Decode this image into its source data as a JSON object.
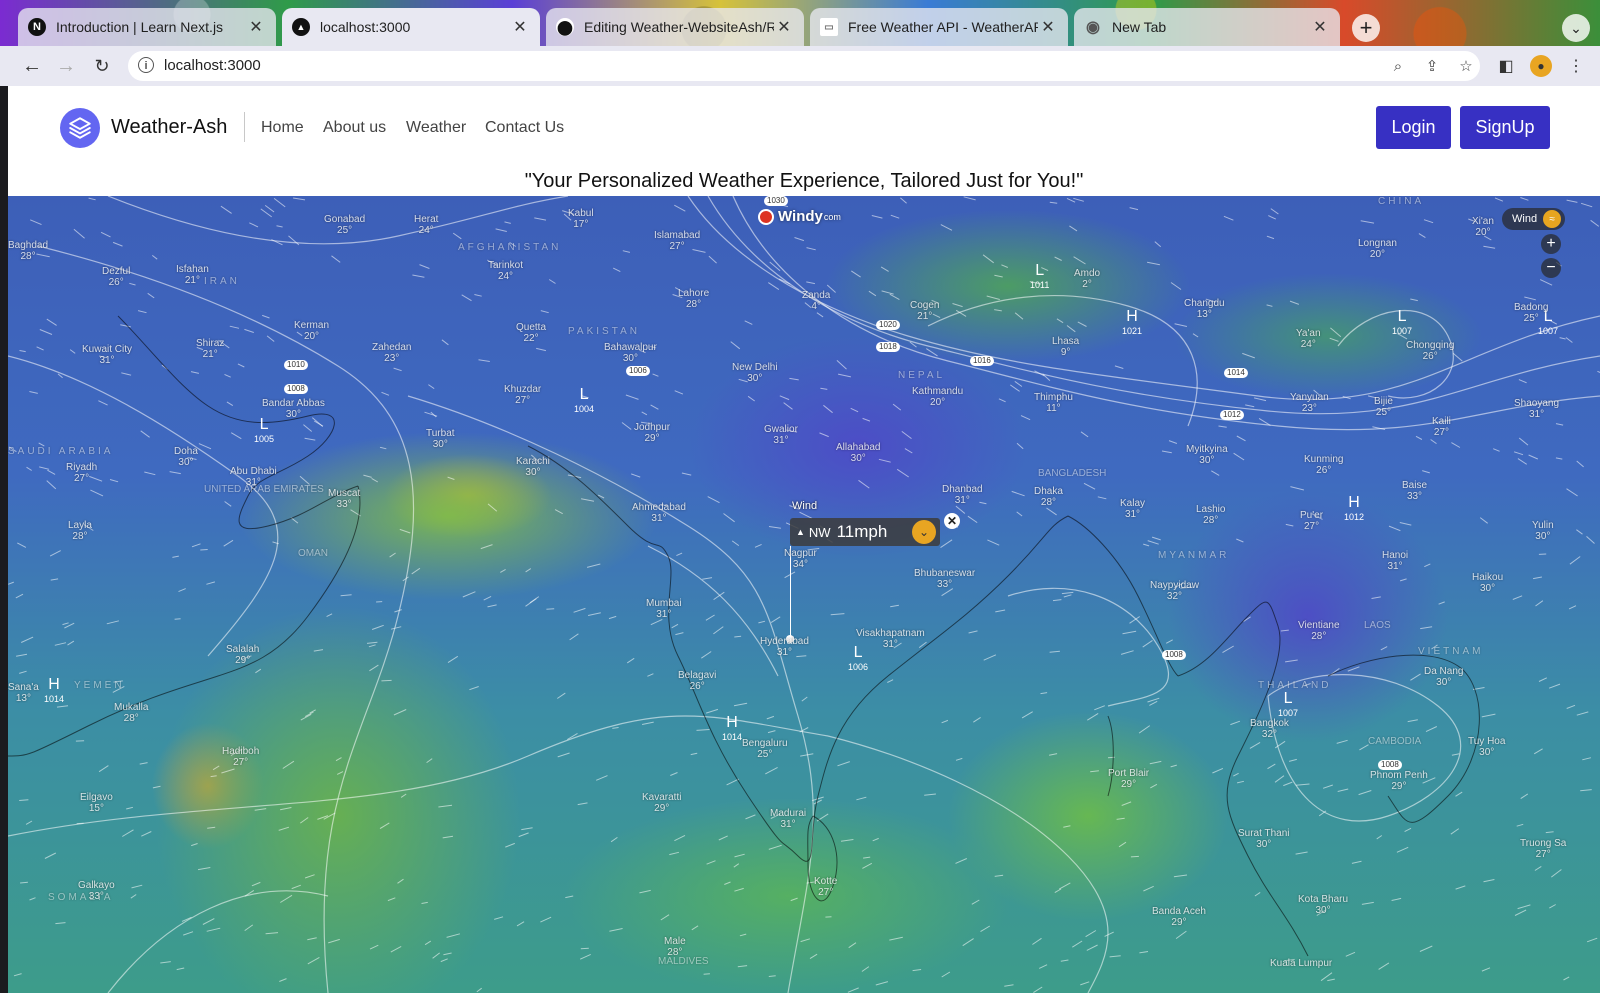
{
  "browser": {
    "tabs": [
      {
        "title": "Introduction | Learn Next.js",
        "favicon": "N"
      },
      {
        "title": "localhost:3000",
        "favicon": "▲"
      },
      {
        "title": "Editing Weather-WebsiteAsh/R",
        "favicon": "⬤"
      },
      {
        "title": "Free Weather API - WeatherAPI",
        "favicon": "▭"
      },
      {
        "title": "New Tab",
        "favicon": "◉"
      }
    ],
    "url": "localhost:3000"
  },
  "navbar": {
    "brand": "Weather-Ash",
    "links": [
      "Home",
      "About us",
      "Weather",
      "Contact Us"
    ],
    "login_label": "Login",
    "signup_label": "SignUp",
    "accent": "#3730c3",
    "logo_color": "#6366f1"
  },
  "tagline": "\"Your Personalized Weather Experience, Tailored Just for You!\"",
  "map": {
    "brand": "Windy",
    "brand_suffix": "com",
    "layer_label": "Wind",
    "zoom_in": "+",
    "zoom_out": "−",
    "popup": {
      "label": "Wind",
      "direction": "NW",
      "speed": "11mph"
    },
    "cities": [
      {
        "name": "Baghdad",
        "temp": "28°"
      },
      {
        "name": "Gonabad",
        "temp": "25°"
      },
      {
        "name": "Herat",
        "temp": "24°"
      },
      {
        "name": "Kabul",
        "temp": "17°"
      },
      {
        "name": "Islamabad",
        "temp": "27°"
      },
      {
        "name": "Dezful",
        "temp": "26°"
      },
      {
        "name": "Isfahan",
        "temp": "21°"
      },
      {
        "name": "Tarinkot",
        "temp": "24°"
      },
      {
        "name": "Lahore",
        "temp": "28°"
      },
      {
        "name": "Zanda",
        "temp": "4°"
      },
      {
        "name": "Kerman",
        "temp": "20°"
      },
      {
        "name": "Shiraz",
        "temp": "21°"
      },
      {
        "name": "Kuwait City",
        "temp": "31°"
      },
      {
        "name": "Zahedan",
        "temp": "23°"
      },
      {
        "name": "Quetta",
        "temp": "22°"
      },
      {
        "name": "Bahawalpur",
        "temp": "30°"
      },
      {
        "name": "New Delhi",
        "temp": "30°"
      },
      {
        "name": "Cogen",
        "temp": "21°"
      },
      {
        "name": "Amdo",
        "temp": "2°"
      },
      {
        "name": "Lhasa",
        "temp": "9°"
      },
      {
        "name": "Changdu",
        "temp": "13°"
      },
      {
        "name": "Longnan",
        "temp": "20°"
      },
      {
        "name": "Xi'an",
        "temp": "20°"
      },
      {
        "name": "Bandar Abbas",
        "temp": "30°"
      },
      {
        "name": "Khuzdar",
        "temp": "27°"
      },
      {
        "name": "Jodhpur",
        "temp": "29°"
      },
      {
        "name": "Gwalior",
        "temp": "31°"
      },
      {
        "name": "Kathmandu",
        "temp": "20°"
      },
      {
        "name": "Thimphu",
        "temp": "11°"
      },
      {
        "name": "Ya'an",
        "temp": "24°"
      },
      {
        "name": "Chongqing",
        "temp": "26°"
      },
      {
        "name": "Badong",
        "temp": "25°"
      },
      {
        "name": "Turbat",
        "temp": "30°"
      },
      {
        "name": "Allahabad",
        "temp": "30°"
      },
      {
        "name": "Yanyuan",
        "temp": "23°"
      },
      {
        "name": "Bijie",
        "temp": "25°"
      },
      {
        "name": "Kaili",
        "temp": "27°"
      },
      {
        "name": "Shaoyang",
        "temp": "31°"
      },
      {
        "name": "Doha",
        "temp": "30°"
      },
      {
        "name": "Riyadh",
        "temp": "27°"
      },
      {
        "name": "Abu Dhabi",
        "temp": "31°"
      },
      {
        "name": "Karachi",
        "temp": "30°"
      },
      {
        "name": "Myitkyina",
        "temp": "30°"
      },
      {
        "name": "Muscat",
        "temp": "33°"
      },
      {
        "name": "Ahmedabad",
        "temp": "31°"
      },
      {
        "name": "Dhanbad",
        "temp": "31°"
      },
      {
        "name": "Dhaka",
        "temp": "28°"
      },
      {
        "name": "Kalay",
        "temp": "31°"
      },
      {
        "name": "Lashio",
        "temp": "28°"
      },
      {
        "name": "Kunming",
        "temp": "26°"
      },
      {
        "name": "Baise",
        "temp": "33°"
      },
      {
        "name": "Layla",
        "temp": "28°"
      },
      {
        "name": "Nagpur",
        "temp": "34°"
      },
      {
        "name": "Pu'er",
        "temp": "27°"
      },
      {
        "name": "Yulin",
        "temp": "30°"
      },
      {
        "name": "Bhubaneswar",
        "temp": "33°"
      },
      {
        "name": "Naypyidaw",
        "temp": "32°"
      },
      {
        "name": "Hanoi",
        "temp": "31°"
      },
      {
        "name": "Haikou",
        "temp": "30°"
      },
      {
        "name": "Mumbai",
        "temp": "31°"
      },
      {
        "name": "Salalah",
        "temp": "29°"
      },
      {
        "name": "Hyderabad",
        "temp": "31°"
      },
      {
        "name": "Visakhapatnam",
        "temp": "31°"
      },
      {
        "name": "Vientiane",
        "temp": "28°"
      },
      {
        "name": "Belagavi",
        "temp": "26°"
      },
      {
        "name": "Da Nang",
        "temp": "30°"
      },
      {
        "name": "Sana'a",
        "temp": "13°"
      },
      {
        "name": "Mukalla",
        "temp": "28°"
      },
      {
        "name": "Bengaluru",
        "temp": "25°"
      },
      {
        "name": "Bangkok",
        "temp": "32°"
      },
      {
        "name": "Hadiboh",
        "temp": "27°"
      },
      {
        "name": "Tuy Hoa",
        "temp": "30°"
      },
      {
        "name": "Port Blair",
        "temp": "29°"
      },
      {
        "name": "Phnom Penh",
        "temp": "29°"
      },
      {
        "name": "Eilgavo",
        "temp": "15°"
      },
      {
        "name": "Kavaratti",
        "temp": "29°"
      },
      {
        "name": "Madurai",
        "temp": "31°"
      },
      {
        "name": "Surat Thani",
        "temp": "30°"
      },
      {
        "name": "Truong Sa",
        "temp": "27°"
      },
      {
        "name": "Kotte",
        "temp": "27°"
      },
      {
        "name": "Galkayo",
        "temp": "33°"
      },
      {
        "name": "Banda Aceh",
        "temp": "29°"
      },
      {
        "name": "Kota Bharu",
        "temp": "30°"
      },
      {
        "name": "Male",
        "temp": "28°"
      },
      {
        "name": "Kuala Lumpur",
        "temp": ""
      }
    ],
    "pressure_centers": [
      {
        "type": "L",
        "value": "1005"
      },
      {
        "type": "L",
        "value": "1004"
      },
      {
        "type": "L",
        "value": "1011"
      },
      {
        "type": "H",
        "value": "1021"
      },
      {
        "type": "L",
        "value": "1007"
      },
      {
        "type": "L",
        "value": "1007"
      },
      {
        "type": "H",
        "value": "1012"
      },
      {
        "type": "L",
        "value": "1006"
      },
      {
        "type": "H",
        "value": "1014"
      },
      {
        "type": "H",
        "value": "1014"
      },
      {
        "type": "L",
        "value": "1007"
      }
    ],
    "isobar_labels": [
      "1010",
      "1008",
      "1006",
      "1020",
      "1018",
      "1016",
      "1014",
      "1012",
      "1008",
      "1008",
      "1030"
    ],
    "region_labels": [
      "AFGHANISTAN",
      "IRAN",
      "PAKISTAN",
      "NEPAL",
      "CHINA",
      "BANGLADESH",
      "MYANMAR",
      "THAILAND",
      "VIETNAM",
      "CAMBODIA",
      "YEMEN",
      "OMAN",
      "SOMALIA",
      "UNITED ARAB EMIRATES",
      "SAUDI ARABIA",
      "MALDIVES",
      "LAOS"
    ]
  }
}
